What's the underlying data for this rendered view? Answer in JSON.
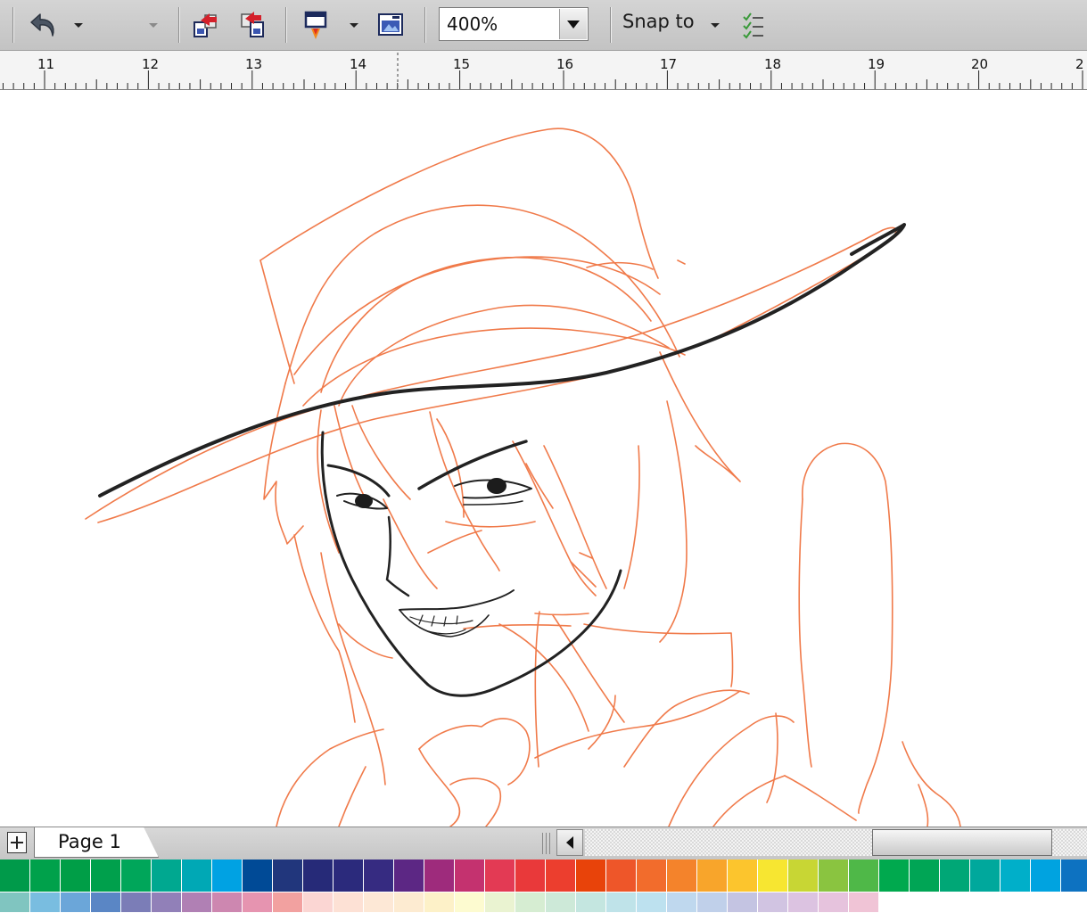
{
  "toolbar": {
    "zoom_value": "400%",
    "snap_label": "Snap to",
    "icons": [
      "undo-icon",
      "redo-icon",
      "import-icon",
      "export-icon",
      "application-launcher-icon",
      "welcome-screen-icon",
      "snap-options-icon"
    ]
  },
  "ruler": {
    "labels": [
      "11",
      "12",
      "13",
      "14",
      "15",
      "16",
      "17",
      "18",
      "19",
      "20",
      "2"
    ]
  },
  "page_bar": {
    "page_tab_label": "Page 1"
  },
  "palette": {
    "row1": [
      "#009a4a",
      "#00a14b",
      "#009e47",
      "#00a04c",
      "#00a65a",
      "#00a890",
      "#00a8b5",
      "#00a2e3",
      "#004a96",
      "#21367c",
      "#262a78",
      "#2b2a7c",
      "#362b81",
      "#5c2784",
      "#9e2b7c",
      "#c4326f",
      "#e33a54",
      "#e9393a",
      "#ec3e2e",
      "#e8430a",
      "#ee5629",
      "#f26c2c",
      "#f4832b",
      "#f8a52b",
      "#fcc52d",
      "#f7e631",
      "#c8d634",
      "#8ac440",
      "#4fb848",
      "#00a94e",
      "#00a555",
      "#00a776",
      "#00a89c",
      "#00afc9",
      "#00a3e0",
      "#0d72c1",
      "#1a5ba8"
    ],
    "row2": [
      "#80c5c0",
      "#79bde0",
      "#6ba6d9",
      "#5a86c5",
      "#7b7db7",
      "#9180b8",
      "#b080b4",
      "#cd87b0",
      "#e694b0",
      "#f2a1a0",
      "#fbd6d3",
      "#fde1d5",
      "#fde8d6",
      "#fdebd1",
      "#fdf1c8",
      "#fdfbd0",
      "#eaf3d1",
      "#d6edd2",
      "#cde9d8",
      "#c4e6e0",
      "#bfe3e9",
      "#bde1ef",
      "#bfd8ee",
      "#c0d0ea",
      "#c4c4e2",
      "#d1c4e2",
      "#dcc3e1",
      "#e6c3dd",
      "#f0c4d6"
    ]
  },
  "accent_colors": {
    "sketch_stroke": "#f07a4a",
    "ink_stroke": "#222222"
  }
}
